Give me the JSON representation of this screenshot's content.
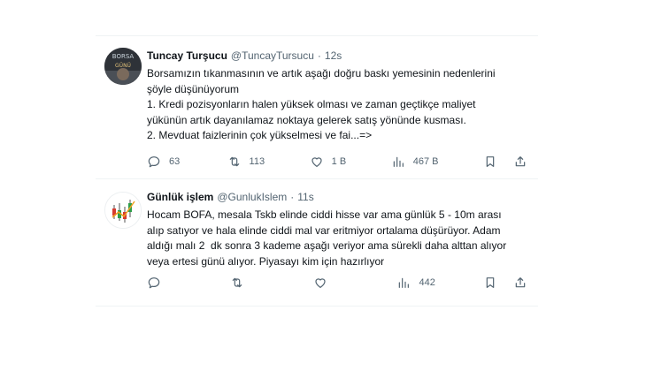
{
  "tweets": [
    {
      "name": "Tuncay Turşucu",
      "handle": "@TuncayTursucu",
      "dot": "·",
      "time": "12s",
      "avatar_text_top": "BORSA",
      "avatar_text_bottom": "GÜNÜ",
      "text": "Borsamızın tıkanmasının ve artık aşağı doğru baskı yemesinin nedenlerini\nşöyle düşünüyorum\n1. Kredi pozisyonların halen yüksek olması ve zaman geçtikçe maliyet\nyükünün artık dayanılamaz noktaya gelerek satış yönünde kusması.\n2. Mevduat faizlerinin çok yükselmesi ve fai...=>",
      "replies": "63",
      "retweets": "113",
      "likes": "1 B",
      "views": "467 B"
    },
    {
      "name": "Günlük işlem",
      "handle": "@GunlukIslem",
      "dot": "·",
      "time": "11s",
      "text": "Hocam BOFA, mesala Tskb elinde ciddi hisse var ama günlük 5 - 10m arası\nalıp satıyor ve hala elinde ciddi mal var eritmiyor ortalama düşürüyor. Adam\naldığı malı 2  dk sonra 3 kademe aşağı veriyor ama sürekli daha alttan alıyor\nveya ertesi günü alıyor. Piyasayı kim için hazırlıyor",
      "replies": "",
      "retweets": "",
      "likes": "",
      "views": "442"
    }
  ],
  "icons": [
    "reply-icon",
    "retweet-icon",
    "like-icon",
    "views-icon",
    "bookmark-icon",
    "share-icon"
  ],
  "colors": {
    "text": "#0f1419",
    "secondary": "#536471",
    "divider": "#eff3f4"
  }
}
